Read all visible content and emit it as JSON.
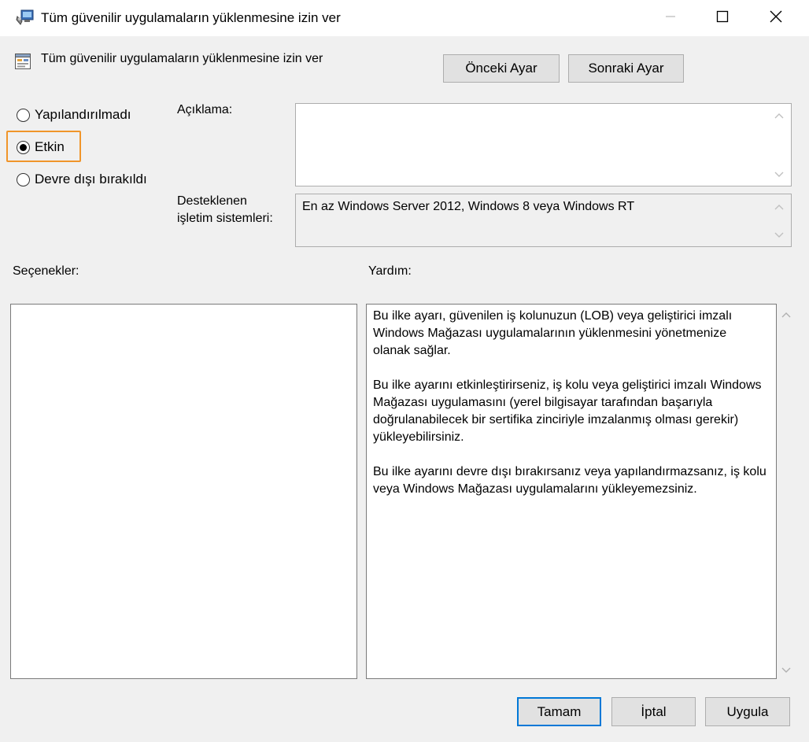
{
  "window": {
    "title": "Tüm güvenilir uygulamaların yüklenmesine izin ver",
    "icon": "policy-window-icon"
  },
  "header": {
    "title": "Tüm güvenilir uygulamaların yüklenmesine izin ver",
    "icon": "setting-icon",
    "prev_label": "Önceki Ayar",
    "next_label": "Sonraki Ayar"
  },
  "state": {
    "options": [
      {
        "label": "Yapılandırılmadı",
        "checked": false
      },
      {
        "label": "Etkin",
        "checked": true
      },
      {
        "label": "Devre dışı bırakıldı",
        "checked": false
      }
    ]
  },
  "description": {
    "label": "Açıklama:",
    "value": ""
  },
  "supported": {
    "label_line1": "Desteklenen",
    "label_line2": "işletim sistemleri:",
    "value": "En az Windows Server 2012, Windows 8 veya Windows RT"
  },
  "options_panel": {
    "label": "Seçenekler:"
  },
  "help_panel": {
    "label": "Yardım:",
    "paragraphs": [
      "Bu ilke ayarı, güvenilen iş kolunuzun (LOB) veya geliştirici imzalı Windows Mağazası uygulamalarının yüklenmesini yönetmenize olanak sağlar.",
      "Bu ilke ayarını etkinleştirirseniz, iş kolu veya geliştirici imzalı Windows Mağazası uygulamasını (yerel bilgisayar tarafından başarıyla doğrulanabilecek bir sertifika zinciriyle imzalanmış olması gerekir) yükleyebilirsiniz.",
      "Bu ilke ayarını devre dışı bırakırsanız veya yapılandırmazsanız, iş kolu veya Windows Mağazası uygulamalarını yükleyemezsiniz."
    ]
  },
  "footer": {
    "ok_label": "Tamam",
    "cancel_label": "İptal",
    "apply_label": "Uygula"
  },
  "colors": {
    "highlight": "#f0952a",
    "focus_border": "#0078d7"
  }
}
